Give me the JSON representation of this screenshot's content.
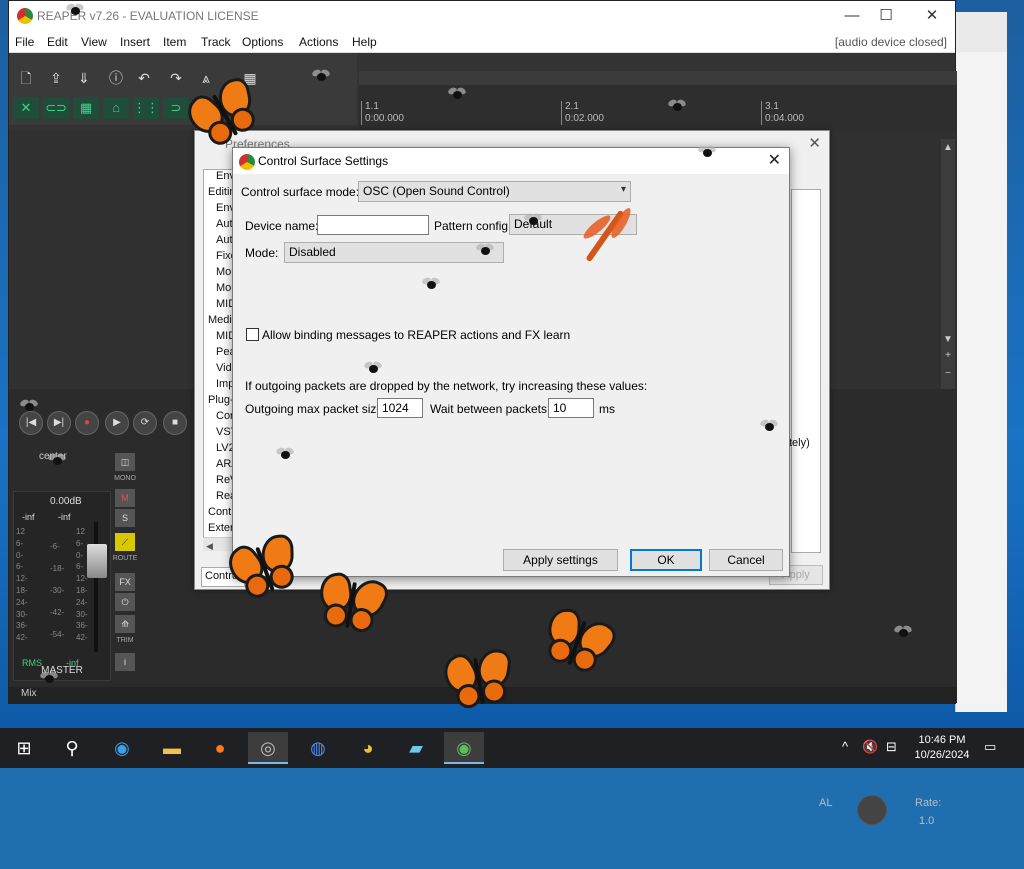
{
  "reaper": {
    "title": "REAPER v7.26 - EVALUATION LICENSE",
    "menu": [
      "File",
      "Edit",
      "View",
      "Insert",
      "Item",
      "Track",
      "Options",
      "Actions",
      "Help"
    ],
    "status": "[audio device closed]",
    "timeline": [
      {
        "bar": "1.1",
        "time": "0:00.000"
      },
      {
        "bar": "2.1",
        "time": "0:02.000"
      },
      {
        "bar": "3.1",
        "time": "0:04.000"
      }
    ],
    "mixer": {
      "center_label": "center",
      "db": "0.00dB",
      "inf_left": "-inf",
      "inf_right": "-inf",
      "scale_left": [
        "12",
        "6-",
        "0-",
        "6-",
        "12-",
        "18-",
        "24-",
        "30-",
        "36-",
        "42-"
      ],
      "scale_right": [
        "12",
        "6-",
        "0-",
        "6-",
        "12-",
        "18-",
        "24-",
        "30-",
        "36-",
        "42-"
      ],
      "scale_mid": [
        "-6-",
        "-18-",
        "-30-",
        "-42-",
        "-54-"
      ],
      "rms_label": "RMS",
      "rms_value": "-inf",
      "master_label": "MASTER",
      "mono": "MONO",
      "m": "M",
      "s": "S",
      "route": "ROUTE",
      "fx": "FX",
      "trim": "TRIM",
      "info": "i",
      "bottom_tab": "Mix",
      "rate_label": "Rate:",
      "rate_value": "1.0",
      "al_label": "AL"
    }
  },
  "prefs": {
    "title": "Preferences",
    "tree": [
      "Env",
      "Editin",
      "Env",
      "Auto",
      "Auto",
      "Fixe",
      "Mou",
      "Mou",
      "MID",
      "Media",
      "MID",
      "Pea",
      "Vide",
      "Imp",
      "Plug-i",
      "Cor",
      "VST",
      "LV2",
      "ARA",
      "ReV",
      "Rea",
      "Contr",
      "Extern"
    ],
    "search_value": "Contro",
    "apply_label": "Apply",
    "note": "tely)"
  },
  "dialog": {
    "title": "Control Surface Settings",
    "mode_label": "Control surface mode:",
    "mode_value": "OSC (Open Sound Control)",
    "device_name_label": "Device name:",
    "device_name_value": "",
    "pattern_label": "Pattern config:",
    "pattern_value": "Default",
    "mode2_label": "Mode:",
    "mode2_value": "Disabled",
    "allow_binding_label": "Allow binding messages to REAPER actions and FX learn",
    "allow_binding_checked": false,
    "packets_note": "If outgoing packets are dropped by the network, try increasing these values:",
    "max_packet_label": "Outgoing max packet size:",
    "max_packet_value": "1024",
    "wait_label": "Wait between packets:",
    "wait_value": "10",
    "wait_unit": "ms",
    "apply_settings": "Apply settings",
    "ok": "OK",
    "cancel": "Cancel"
  },
  "taskbar": {
    "time": "10:46 PM",
    "date": "10/26/2024"
  }
}
